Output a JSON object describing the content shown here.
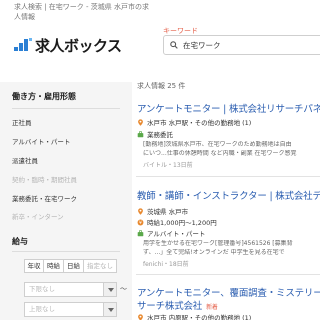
{
  "breadcrumb": "求人検索 | 在宅ワーク - 茨城県 水戸市の求人情報",
  "logo": {
    "text": "求人ボックス",
    "accent": "#2a7fd4"
  },
  "search": {
    "label": "キーワード",
    "value": "在宅ワーク"
  },
  "colors": {
    "accent_orange": "#e5604a",
    "link_blue": "#2a5db0",
    "icon_orange": "#e8892f",
    "icon_green": "#5aa84a",
    "panel_bg": "#f5f5f5"
  },
  "sidebar": {
    "employment_title": "働き方・雇用形態",
    "employment_items": [
      "正社員",
      "アルバイト・パート",
      "派遣社員",
      "契約・臨時・期間社員",
      "業務委託・在宅ワーク",
      "新卒・インターン"
    ],
    "pay_title": "給与",
    "pay_tabs": [
      "年収",
      "時給",
      "日給",
      "指定なし"
    ],
    "pay_select_min": "下限なし",
    "pay_select_max": "上限なし",
    "range_sep": "〜"
  },
  "results": {
    "count": "求人情報 25 件",
    "jobs": [
      {
        "title": "アンケートモニター | 株式会社リサーチパネ",
        "location": "水戸市 水戸駅・その他の勤務地 (1)",
        "employment": "業務委託",
        "excerpt1": "[勤務地]茨城県水戸市、在宅ワークのため勤務地は自由",
        "excerpt2": "にいつ...仕事の休憩時間 など内職・副業 在宅ワーク感覚",
        "meta": "バイトル・13日前"
      },
      {
        "title": "教師・講師・インストラクター | 株式会社デ",
        "location": "茨城県 水戸市",
        "salary": "時給1,000円〜1,200円",
        "employment": "アルバイト・パート",
        "excerpt1": "用学を生かせる在宅ワーク[管理番号]4561526 [募集背",
        "excerpt2": "ず、...」全て完結!オンラインだ 中学生を見る在宅で",
        "meta": "fenichi・18日前"
      },
      {
        "title": "アンケートモニター、覆面調査・ミステリー",
        "title2": "サーチ株式会社",
        "badge": "新着",
        "location": "水戸市 内原駅・その他の勤務地 (1)"
      }
    ]
  }
}
